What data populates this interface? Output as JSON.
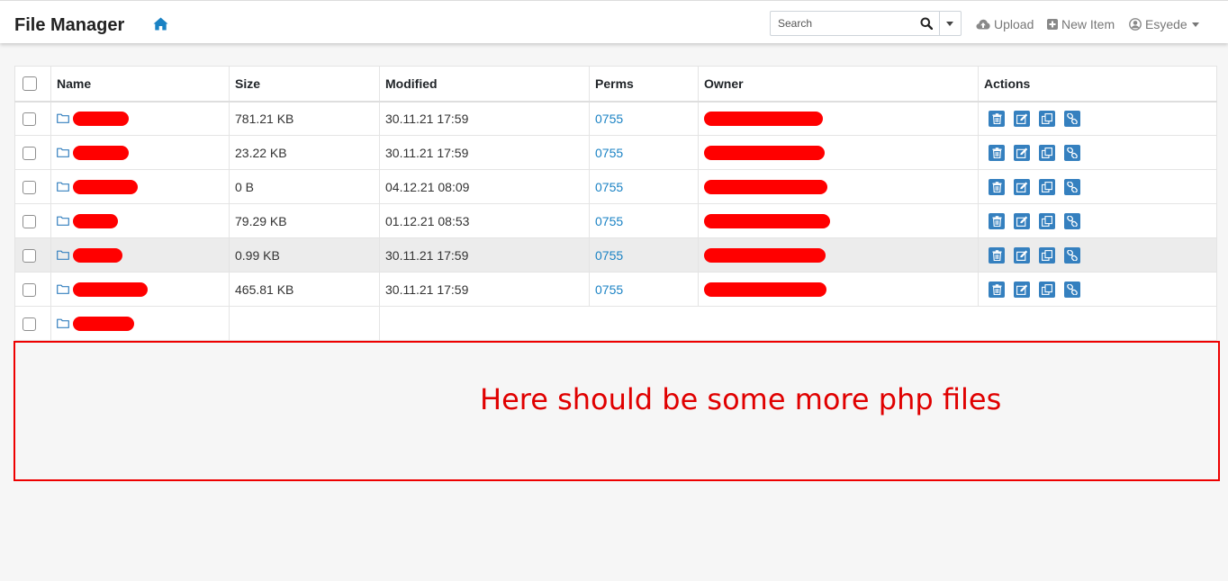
{
  "app": {
    "title": "File Manager"
  },
  "header": {
    "search_placeholder": "Search",
    "upload_label": "Upload",
    "new_item_label": "New Item",
    "user_label": "Esyede"
  },
  "table": {
    "columns": [
      "Name",
      "Size",
      "Modified",
      "Perms",
      "Owner",
      "Actions"
    ],
    "rows": [
      {
        "size": "781.21 KB",
        "modified": "30.11.21 17:59",
        "perms": "0755"
      },
      {
        "size": "23.22 KB",
        "modified": "30.11.21 17:59",
        "perms": "0755"
      },
      {
        "size": "0 B",
        "modified": "04.12.21 08:09",
        "perms": "0755"
      },
      {
        "size": "79.29 KB",
        "modified": "01.12.21 08:53",
        "perms": "0755"
      },
      {
        "size": "0.99 KB",
        "modified": "30.11.21 17:59",
        "perms": "0755"
      },
      {
        "size": "465.81 KB",
        "modified": "30.11.21 17:59",
        "perms": "0755"
      }
    ],
    "highlighted_row_index": 4
  },
  "annotation": {
    "text": "Here should be some more php files"
  },
  "colors": {
    "accent": "#3580bf",
    "perm_link": "#1a82c4",
    "redaction": "#ff0000",
    "annotation": "#e00000"
  },
  "icons": {
    "nav": [
      "home-icon",
      "search-icon",
      "cloud-upload-icon",
      "plus-square-icon",
      "user-circle-icon"
    ],
    "row": [
      "folder-icon"
    ],
    "actions": [
      "trash-icon",
      "edit-icon",
      "copy-icon",
      "link-icon"
    ]
  }
}
